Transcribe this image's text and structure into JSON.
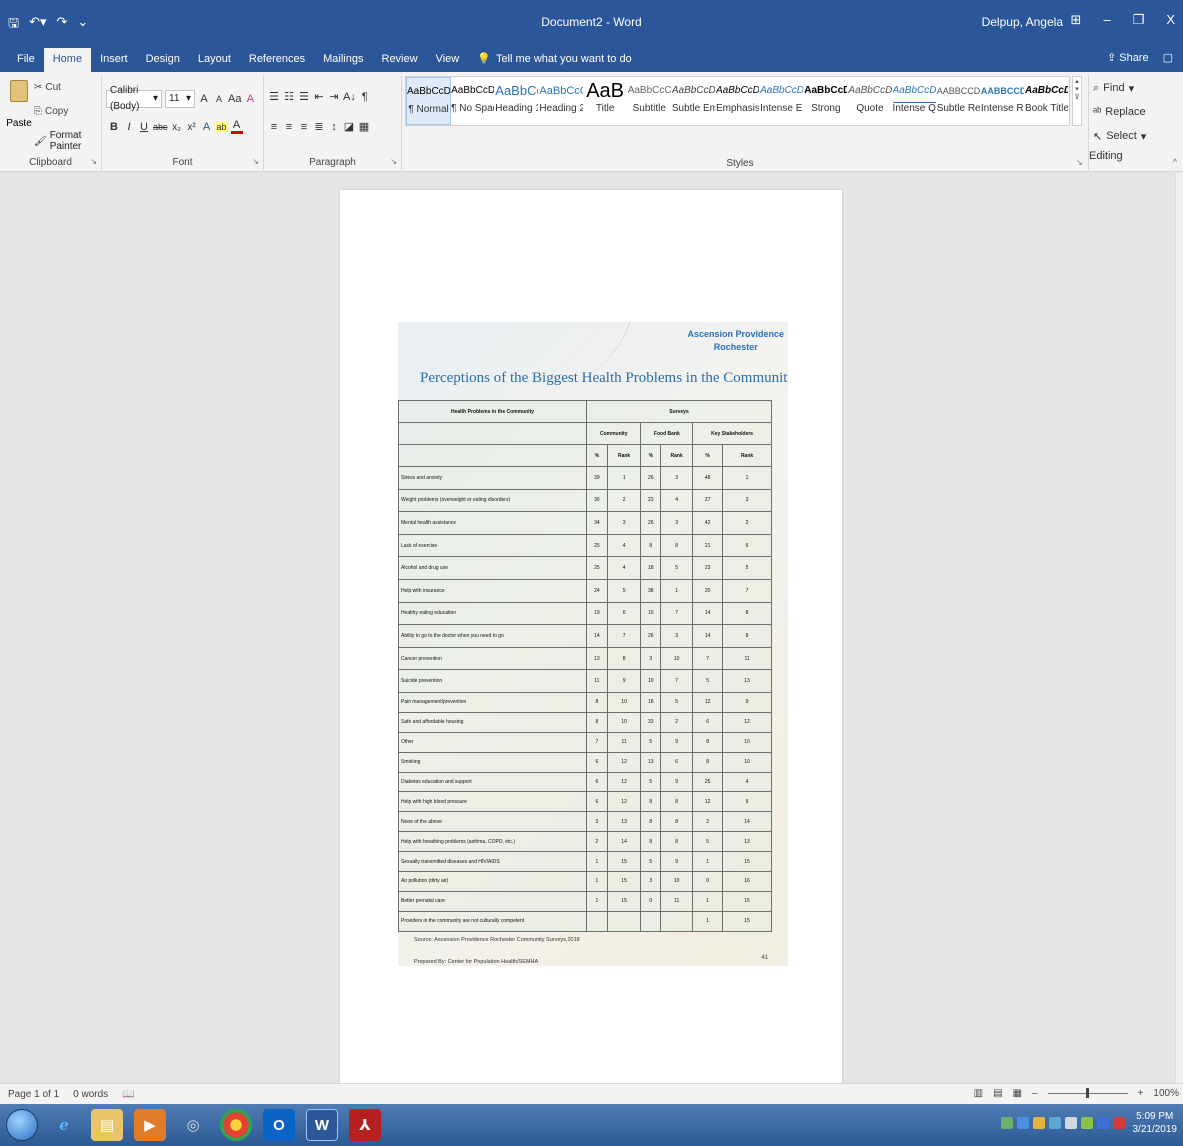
{
  "titlebar": {
    "save_icon": "save-icon",
    "undo_icon": "undo-icon",
    "redo_icon": "redo-icon",
    "doc_title": "Document2 - Word",
    "user_name": "Delpup, Angela",
    "ribbon_display_icon": "ribbon-display-icon",
    "minimize": "–",
    "restore": "❐",
    "close": "X"
  },
  "tabs": {
    "items": [
      "File",
      "Home",
      "Insert",
      "Design",
      "Layout",
      "References",
      "Mailings",
      "Review",
      "View"
    ],
    "tell_me": "Tell me what you want to do",
    "share": "Share"
  },
  "clipboard": {
    "cut": "Cut",
    "copy": "Copy",
    "paste": "Paste",
    "format_painter": "Format Painter",
    "label": "Clipboard"
  },
  "font": {
    "family": "Calibri (Body)",
    "size": "11",
    "grow": "A",
    "shrink": "A",
    "case": "Aa",
    "clear": "A",
    "label": "Font",
    "bold": "B",
    "italic": "I",
    "underline": "U",
    "strike": "abc",
    "subscript": "x₂",
    "superscript": "x²",
    "text_effects": "A",
    "highlight": "ab",
    "font_color": "A"
  },
  "paragraph": {
    "label": "Paragraph",
    "sort": "A↓",
    "pilcrow": "¶"
  },
  "styles": {
    "label": "Styles",
    "items": [
      {
        "preview": "AaBbCcDc",
        "name": "¶ Normal"
      },
      {
        "preview": "AaBbCcDc",
        "name": "¶ No Spac..."
      },
      {
        "preview": "AaBbCc",
        "name": "Heading 1"
      },
      {
        "preview": "AaBbCcC",
        "name": "Heading 2"
      },
      {
        "preview": "AaB",
        "name": "Title"
      },
      {
        "preview": "AaBbCcC",
        "name": "Subtitle"
      },
      {
        "preview": "AaBbCcDc",
        "name": "Subtle Em..."
      },
      {
        "preview": "AaBbCcDc",
        "name": "Emphasis"
      },
      {
        "preview": "AaBbCcDc",
        "name": "Intense E..."
      },
      {
        "preview": "AaBbCcDc",
        "name": "Strong"
      },
      {
        "preview": "AaBbCcDc",
        "name": "Quote"
      },
      {
        "preview": "AaBbCcDc",
        "name": "Intense Q..."
      },
      {
        "preview": "AABBCCDC",
        "name": "Subtle Ref..."
      },
      {
        "preview": "AABBCCDC",
        "name": "Intense Re..."
      },
      {
        "preview": "AaBbCcDc",
        "name": "Book Title"
      }
    ]
  },
  "editing": {
    "label": "Editing",
    "find": "Find",
    "replace": "Replace",
    "select": "Select"
  },
  "slide": {
    "org_line1": "Ascension Providence",
    "org_line2": "Rochester",
    "title": "Perceptions of the Biggest Health Problems in the Community",
    "col_problem": "Health Problems in the Community",
    "col_surveys": "Surveys",
    "groups": [
      "Community",
      "Food Bank",
      "Key Stakeholders"
    ],
    "pct": "%",
    "rank": "Rank",
    "rows": [
      [
        "Stress and anxiety",
        "39",
        "1",
        "26",
        "3",
        "48",
        "1"
      ],
      [
        "Weight problems (overweight or eating disorders)",
        "36",
        "2",
        "23",
        "4",
        "27",
        "3"
      ],
      [
        "Mental health assistance",
        "34",
        "3",
        "26",
        "3",
        "42",
        "2"
      ],
      [
        "Lack of exercise",
        "25",
        "4",
        "8",
        "8",
        "21",
        "6"
      ],
      [
        "Alcohol and drug use",
        "25",
        "4",
        "18",
        "5",
        "23",
        "5"
      ],
      [
        "Help with insurance",
        "24",
        "5",
        "38",
        "1",
        "20",
        "7"
      ],
      [
        "Healthy eating education",
        "19",
        "6",
        "10",
        "7",
        "14",
        "8"
      ],
      [
        "Ability to go to the doctor when you need to go",
        "14",
        "7",
        "26",
        "3",
        "14",
        "8"
      ],
      [
        "Cancer prevention",
        "13",
        "8",
        "3",
        "10",
        "7",
        "11"
      ],
      [
        "Suicide prevention",
        "11",
        "9",
        "10",
        "7",
        "5",
        "13"
      ],
      [
        "Pain management/prevention",
        "8",
        "10",
        "18",
        "5",
        "12",
        "9"
      ],
      [
        "Safe and affordable housing",
        "8",
        "10",
        "33",
        "2",
        "6",
        "12"
      ],
      [
        "Other",
        "7",
        "11",
        "5",
        "9",
        "8",
        "10"
      ],
      [
        "Smoking",
        "6",
        "12",
        "13",
        "6",
        "8",
        "10"
      ],
      [
        "Diabetes education and support",
        "6",
        "12",
        "5",
        "9",
        "25",
        "4"
      ],
      [
        "Help with high blood pressure",
        "6",
        "12",
        "8",
        "8",
        "12",
        "9"
      ],
      [
        "None of the above",
        "3",
        "13",
        "8",
        "8",
        "2",
        "14"
      ],
      [
        "Help with breathing problems (asthma, COPD, etc.)",
        "2",
        "14",
        "8",
        "8",
        "5",
        "13"
      ],
      [
        "Sexually transmitted diseases and HIV/AIDS",
        "1",
        "15",
        "5",
        "9",
        "1",
        "15"
      ],
      [
        "Air pollution (dirty air)",
        "1",
        "15",
        "3",
        "10",
        "0",
        "16"
      ],
      [
        "Better prenatal care",
        "1",
        "15",
        "0",
        "11",
        "1",
        "15"
      ],
      [
        "Providers in the community are not culturally competent",
        "",
        "",
        "",
        "",
        "1",
        "15"
      ]
    ],
    "source": "Source: Ascension Providence Rochester Community Surveys,2018",
    "prepared": "Prepared By: Center for Population Health/SEMHA",
    "page_number": "41"
  },
  "statusbar": {
    "page": "Page 1 of 1",
    "words": "0 words",
    "zoom": "100%"
  },
  "taskbar": {
    "time": "5:09 PM",
    "date": "3/21/2019"
  },
  "colors": {
    "word_blue": "#2b579a",
    "slide_title": "#2e6ea6",
    "org_blue": "#2a72b5"
  }
}
